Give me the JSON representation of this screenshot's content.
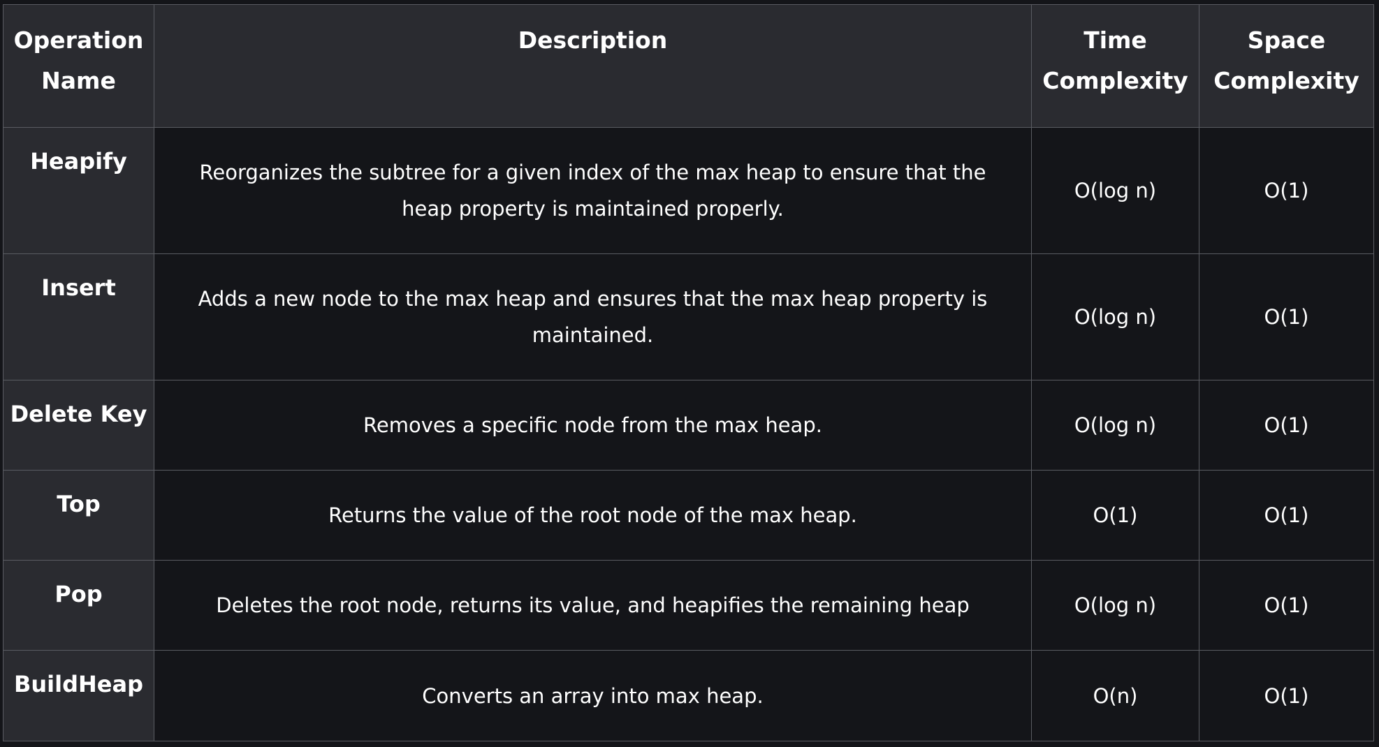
{
  "table": {
    "headers": [
      "Operation Name",
      "Description",
      "Time Complexity",
      "Space Complexity"
    ],
    "rows": [
      {
        "name": "Heapify",
        "description": "Reorganizes the subtree for a given index of the max heap to ensure that the heap property is maintained properly.",
        "time": "O(log n)",
        "space": "O(1)"
      },
      {
        "name": "Insert",
        "description": "Adds a new node to the max heap and ensures that the max heap property is maintained.",
        "time": "O(log n)",
        "space": "O(1)"
      },
      {
        "name": "Delete Key",
        "description": "Removes a specific node from the max heap.",
        "time": "O(log n)",
        "space": "O(1)"
      },
      {
        "name": "Top",
        "description": "Returns the value of the root node of the max heap.",
        "time": "O(1)",
        "space": "O(1)"
      },
      {
        "name": "Pop",
        "description": "Deletes the root node, returns its value, and heapifies the remaining heap",
        "time": "O(log n)",
        "space": "O(1)"
      },
      {
        "name": "BuildHeap",
        "description": "Converts an array into max heap.",
        "time": "O(n)",
        "space": "O(1)"
      }
    ]
  },
  "colors": {
    "header_bg": "#2a2b30",
    "body_bg": "#141519",
    "border": "#5a5c62",
    "text": "#ffffff"
  }
}
